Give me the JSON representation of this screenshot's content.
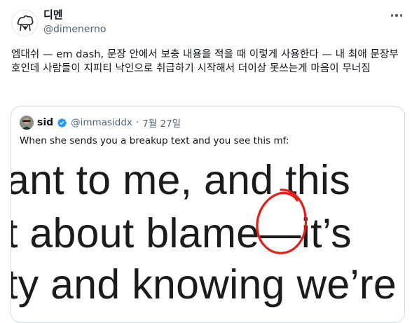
{
  "author": {
    "display_name": "디멘",
    "handle": "@dimenerno"
  },
  "tweet": {
    "text": "엠대쉬 — em dash, 문장 안에서 보충 내용을 적을 때 이렇게 사용한다 — 내 최애 문장부호인데 사람들이 지피티 낙인으로 취급하기 시작해서 더이상 못쓰는게 마음이 무너짐"
  },
  "quote": {
    "display_name": "sid",
    "handle": "@immasiddx",
    "separator": "·",
    "date": "7월 27일",
    "text": "When she sends you a breakup text and you see this mf:",
    "media_lines": [
      "ant to me, and this",
      "t about blame—it’s",
      "ty and knowing we’re"
    ]
  },
  "colors": {
    "text_primary": "#0f1419",
    "text_secondary": "#536471",
    "border": "#cfd9de",
    "verified_blue": "#1d9bf0",
    "circle_red": "#e0201b"
  },
  "icons": {
    "more": "more-horizontal-icon",
    "verified": "verified-badge-icon"
  }
}
